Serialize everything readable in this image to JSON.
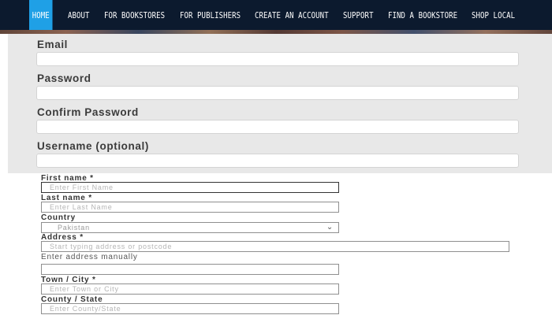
{
  "nav": {
    "items": [
      "HOME",
      "ABOUT",
      "FOR BOOKSTORES",
      "FOR PUBLISHERS",
      "CREATE AN ACCOUNT",
      "SUPPORT",
      "FIND A BOOKSTORE",
      "SHOP LOCAL"
    ],
    "active": "HOME",
    "active_color": "#1fa0e6",
    "background": "#0c1a2e"
  },
  "account": {
    "email_label": "Email",
    "password_label": "Password",
    "confirm_password_label": "Confirm Password",
    "username_label": "Username (optional)"
  },
  "address_form": {
    "first_name_label": "First name *",
    "first_name_placeholder": "Enter First Name",
    "last_name_label": "Last name *",
    "last_name_placeholder": "Enter Last Name",
    "country_label": "Country",
    "country_value": "Pakistan",
    "address_label": "Address *",
    "address_placeholder": "Start typing address or postcode",
    "manual_link": "Enter address manually",
    "town_label": "Town / City *",
    "town_placeholder": "Enter Town or City",
    "county_label": "County / State",
    "county_placeholder": "Enter County/State"
  },
  "icons": {
    "country_dropdown": "chevron-down-icon"
  }
}
